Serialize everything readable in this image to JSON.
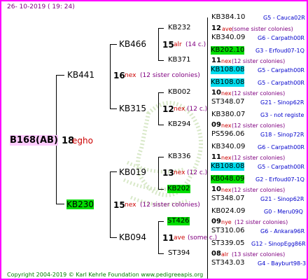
{
  "header": "26- 10-2019 ( 19: 24)",
  "footer": "Copyright 2004-2019 © Karl Kehrle Foundation    www.pedigreeapis.org",
  "colors": {
    "border": "#ff00ff",
    "highlight_green": "#00dd00",
    "highlight_cyan": "#00ddee",
    "highlight_root": "#ffccff",
    "year_red": "#cc0000",
    "colony_purple": "#800080",
    "note_blue": "#0000cc"
  },
  "root": {
    "id": "B168(AB)",
    "year": "18",
    "origin": "egho"
  },
  "gen1": [
    {
      "id": "KB441",
      "year": "16",
      "suffix": "nex",
      "note": "(12 sister colonies)"
    },
    {
      "id": "KB230",
      "year": "15",
      "suffix": "nex",
      "note": "(12 sister colonies)"
    }
  ],
  "gen2": [
    {
      "id": "KB466",
      "year": "15",
      "suffix": "alr",
      "note": "(14 c.)"
    },
    {
      "id": "KB315",
      "year": "12",
      "suffix": "nex",
      "note": "(12 c.)"
    },
    {
      "id": "KB019",
      "year": "13",
      "suffix": "nex",
      "note": "(12 c.)"
    },
    {
      "id": "KB094",
      "year": "11",
      "suffix": "ave",
      "note": "(some c.)"
    }
  ],
  "gen3": [
    {
      "id": "KB232",
      "year": "12",
      "suffix": "ave",
      "note": "(some sister colonies)"
    },
    {
      "id": "KB371",
      "year": "11",
      "suffix": "nex",
      "note": "(12 sister colonies)"
    },
    {
      "id": "KB002",
      "year": "10",
      "suffix": "nex",
      "note": "(12 sister colonies)"
    },
    {
      "id": "KB294",
      "year": "09",
      "suffix": "nex",
      "note": "(12 sister colonies)"
    },
    {
      "id": "KB336",
      "year": "11",
      "suffix": "nex",
      "note": "(12 sister colonies)"
    },
    {
      "id": "KB202",
      "year": "10",
      "suffix": "nex",
      "note": "(12 sister colonies)"
    },
    {
      "id": "ST426",
      "year": "09",
      "suffix": "nye",
      "note": "(12 sister colonies)"
    },
    {
      "id": "ST394",
      "year": "08",
      "suffix": "alr",
      "note": "(13 sister colonies)"
    }
  ],
  "gen4": [
    {
      "id": "KB384.10",
      "note": "G5 - Cauca02R"
    },
    {
      "id": "KB340.09",
      "note": "G6 - Carpath00R"
    },
    {
      "id": "KB202.10",
      "note": "G3 - Erfoud07-1Q"
    },
    {
      "id": "KB108.08",
      "note": "G5 - Carpath00R"
    },
    {
      "id": "KB108.08",
      "note": "G5 - Carpath00R"
    },
    {
      "id": "ST348.07",
      "note": "G21 - Sinop62R"
    },
    {
      "id": "KB380.07",
      "note": "G3 - not registe"
    },
    {
      "id": "PS596.06",
      "note": "G18 - Sinop72R"
    },
    {
      "id": "KB340.09",
      "note": "G6 - Carpath00R"
    },
    {
      "id": "KB108.08",
      "note": "G5 - Carpath00R"
    },
    {
      "id": "KB048.09",
      "note": "G2 - Erfoud07-1Q"
    },
    {
      "id": "ST348.07",
      "note": "G21 - Sinop62R"
    },
    {
      "id": "KB024.09",
      "note": "G0 - Meru09Q"
    },
    {
      "id": "ST310.06",
      "note": "G6 - Ankara96R"
    },
    {
      "id": "ST339.05",
      "note": "G12 - SinopEgg86R"
    },
    {
      "id": "ST343.03",
      "note": "G4 - Bayburt98-3"
    }
  ]
}
